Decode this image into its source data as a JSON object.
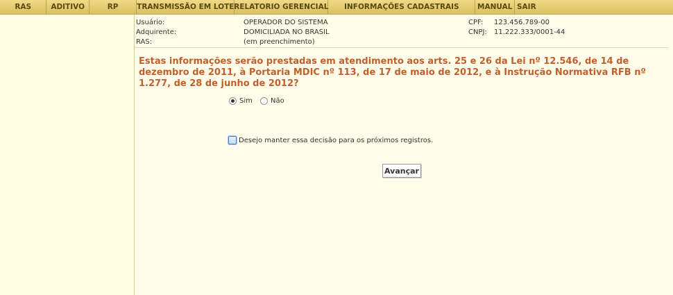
{
  "menu": [
    {
      "label": "RAS"
    },
    {
      "label": "ADITIVO"
    },
    {
      "label": "RP"
    },
    {
      "label": "TRANSMISSÃO EM LOTE"
    },
    {
      "label": "RELATORIO GERENCIAL"
    },
    {
      "label": "INFORMAÇÕES CADASTRAIS"
    },
    {
      "label": "MANUAL"
    },
    {
      "label": "SAIR"
    }
  ],
  "info": {
    "usuario_label": "Usuário:",
    "usuario_value": "OPERADOR DO SISTEMA",
    "adquirente_label": "Adquirente:",
    "adquirente_value": "DOMICILIADA NO BRASIL",
    "ras_label": "RAS:",
    "ras_value": "(em preenchimento)",
    "cpf_label": "CPF:",
    "cpf_value": "123.456.789-00",
    "cnpj_label": "CNPJ:",
    "cnpj_value": "11.222.333/0001-44"
  },
  "question": "Estas informações serão prestadas em atendimento aos arts. 25 e 26 da Lei nº 12.546, de 14 de dezembro de 2011, à Portaria MDIC nº 113, de 17 de maio de 2012, e à Instrução Normativa RFB nº 1.277, de 28 de junho de 2012?",
  "options": {
    "sim": "Sim",
    "nao": "Não",
    "selected": "Sim"
  },
  "keep_decision": "Desejo manter essa decisão para os próximos registros.",
  "submit": "Avançar",
  "colors": {
    "menubar": "#e8cf78",
    "question": "#c0602c",
    "background": "#fffde9"
  }
}
